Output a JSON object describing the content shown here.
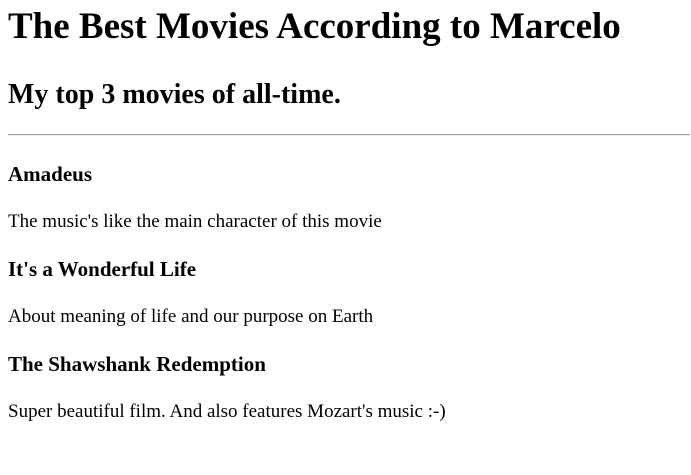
{
  "page": {
    "title": "The Best Movies According to Marcelo",
    "subtitle": "My top 3 movies of all-time."
  },
  "movies": [
    {
      "title": "Amadeus",
      "description": "The music's like the main character of this movie"
    },
    {
      "title": "It's a Wonderful Life",
      "description": "About meaning of life and our purpose on Earth"
    },
    {
      "title": "The Shawshank Redemption",
      "description": "Super beautiful film. And also features Mozart's music :-)"
    }
  ]
}
